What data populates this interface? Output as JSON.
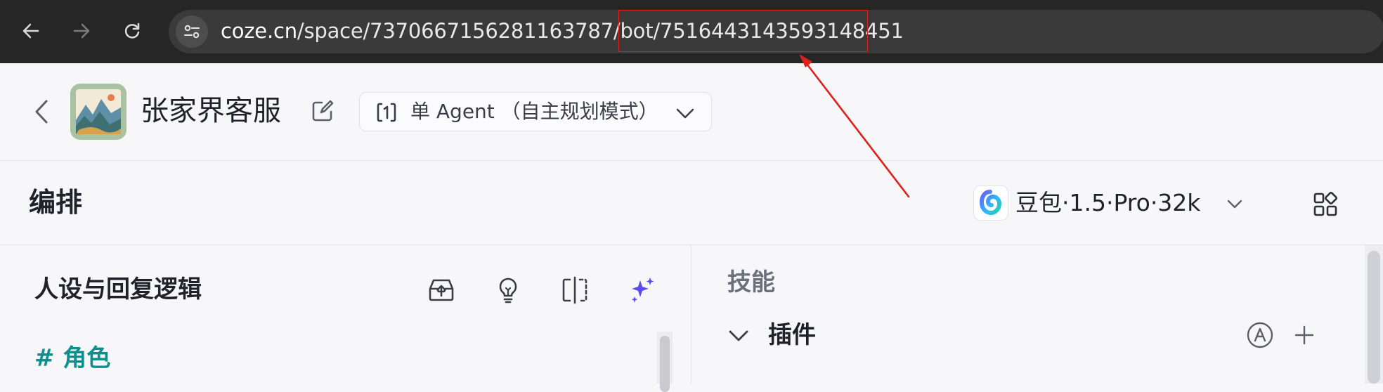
{
  "browser": {
    "url_host": "coze.cn",
    "url_path": "/space/7370667156281163787/bot/",
    "url_highlight": "7516443143593148451"
  },
  "header": {
    "bot_name": "张家界客服",
    "agent_mode": "单 Agent （自主规划模式）"
  },
  "toolbar": {
    "title": "编排",
    "model_name": "豆包·1.5·Pro·32k"
  },
  "persona": {
    "title": "人设与回复逻辑",
    "role_heading": "# 角色"
  },
  "skills": {
    "title": "技能",
    "plugins_label": "插件"
  },
  "colors": {
    "annotation": "#e0201c",
    "role_heading": "#0f8e8e",
    "optimize_icon": "#5a4cf0"
  }
}
